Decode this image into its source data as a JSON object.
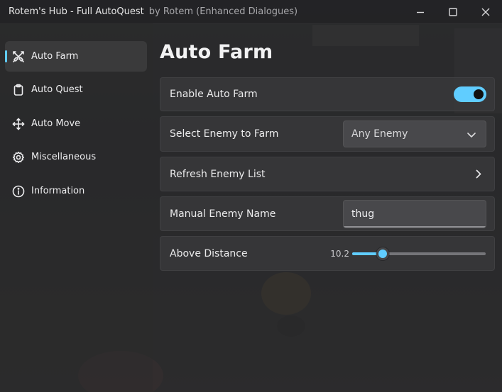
{
  "window": {
    "title": "Rotem's Hub - Full AutoQuest",
    "subtitle": "by Rotem (Enhanced Dialogues)"
  },
  "icons": {
    "minimize": "minimize-icon",
    "maximize": "maximize-icon",
    "close": "close-icon"
  },
  "sidebar": {
    "items": [
      {
        "label": "Auto Farm",
        "icon": "swords-icon",
        "active": true
      },
      {
        "label": "Auto Quest",
        "icon": "clipboard-icon",
        "active": false
      },
      {
        "label": "Auto Move",
        "icon": "move-arrows-icon",
        "active": false
      },
      {
        "label": "Miscellaneous",
        "icon": "gear-icon",
        "active": false
      },
      {
        "label": "Information",
        "icon": "info-icon",
        "active": false
      }
    ]
  },
  "main": {
    "title": "Auto Farm",
    "rows": {
      "enable_auto_farm": {
        "label": "Enable Auto Farm",
        "enabled": true
      },
      "select_enemy": {
        "label": "Select Enemy to Farm",
        "selected": "Any Enemy"
      },
      "refresh": {
        "label": "Refresh Enemy List"
      },
      "manual_name": {
        "label": "Manual Enemy Name",
        "value": "thug"
      },
      "above_distance": {
        "label": "Above Distance",
        "value": "10.2",
        "fraction": 0.23
      }
    }
  },
  "colors": {
    "accent": "#60cdff"
  }
}
